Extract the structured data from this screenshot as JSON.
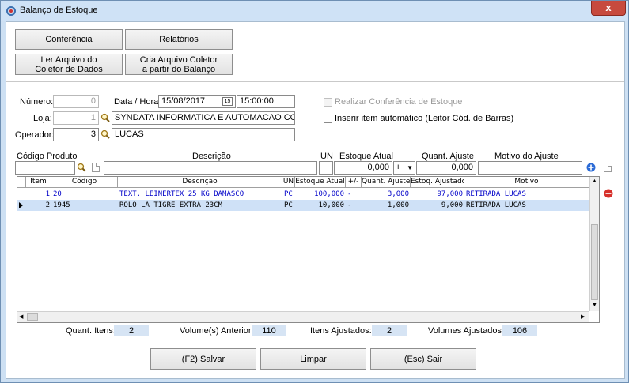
{
  "window": {
    "title": "Balanço de Estoque",
    "close_label": "x"
  },
  "toolbar": {
    "conferencia": "Conferência",
    "relatorios": "Relatórios",
    "ler_arquivo": [
      "Ler Arquivo do",
      "Coletor de Dados"
    ],
    "cria_arquivo": [
      "Cria Arquivo Coletor",
      "a partir do Balanço"
    ]
  },
  "form": {
    "numero_label": "Número:",
    "numero_value": "0",
    "data_hora_label": "Data / Hora:",
    "data_value": "15/08/2017",
    "calendar_label": "15",
    "hora_value": "15:00:00",
    "loja_label": "Loja:",
    "loja_code": "1",
    "loja_name": "SYNDATA INFORMATICA E AUTOMACAO COME",
    "operador_label": "Operador:",
    "operador_code": "3",
    "operador_name": "LUCAS",
    "realizar_conferencia": "Realizar Conferência de Estoque",
    "inserir_automatico": "Inserir item automático (Leitor Cód. de Barras)"
  },
  "entry": {
    "codigo_label": "Código Produto",
    "descricao_label": "Descrição",
    "un_label": "UN",
    "estoque_label": "Estoque Atual",
    "quant_label": "Quant. Ajuste",
    "motivo_label": "Motivo do Ajuste",
    "estoque_value": "0,000",
    "sign_value": "+",
    "quant_value": "0,000"
  },
  "grid": {
    "headers": [
      "Item",
      "Código",
      "Descrição",
      "UN",
      "Estoque Atual",
      "+/-",
      "Quant. Ajuste",
      "Estoq. Ajustado",
      "Motivo"
    ],
    "rows": [
      {
        "item": "1",
        "codigo": "20",
        "descricao": "TEXT. LEINERTEX 25 KG DAMASCO",
        "un": "PC",
        "estoque": "100,000",
        "sinal": "-",
        "quant": "3,000",
        "ajustado": "97,000",
        "motivo": "RETIRADA LUCAS"
      },
      {
        "item": "2",
        "codigo": "1945",
        "descricao": "ROLO LA TIGRE EXTRA 23CM",
        "un": "PC",
        "estoque": "10,000",
        "sinal": "-",
        "quant": "1,000",
        "ajustado": "9,000",
        "motivo": "RETIRADA LUCAS"
      }
    ]
  },
  "summary": {
    "quant_itens_label": "Quant. Itens:",
    "quant_itens": "2",
    "volume_anterior_label": "Volume(s) Anterior:",
    "volume_anterior": "110",
    "itens_ajustados_label": "Itens Ajustados:",
    "itens_ajustados": "2",
    "volumes_ajustados_label": "Volumes Ajustados:",
    "volumes_ajustados": "106"
  },
  "footer": {
    "salvar": "(F2) Salvar",
    "limpar": "Limpar",
    "sair": "(Esc) Sair"
  },
  "colors": {
    "title_bg": "#cfe2f6",
    "close_red": "#c74a3e",
    "row_blue": "#0000c8",
    "selected_row": "#cfe1f7",
    "summary_bg": "#d6e4f4"
  }
}
